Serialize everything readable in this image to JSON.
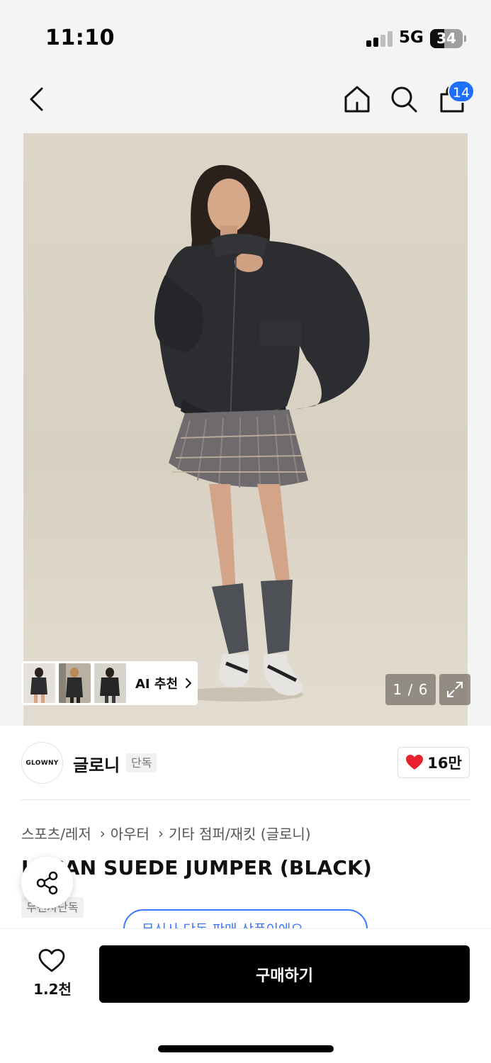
{
  "status_bar": {
    "time": "11:10",
    "network": "5G",
    "battery": "34"
  },
  "nav": {
    "cart_count": "14"
  },
  "gallery": {
    "ai_label": "AI 추천",
    "counter": "1 / 6"
  },
  "brand": {
    "logo_text": "GLOWNY",
    "name": "글로니",
    "tag": "단독",
    "likes": "16만"
  },
  "breadcrumb": [
    "스포츠/레저",
    "아우터",
    "기타 점퍼/재킷 (글로니)"
  ],
  "product": {
    "title": "LUCAN SUEDE JUMPER (BLACK)",
    "exclusive_tag": "무신사단독",
    "info_pill": "무신사 단독 판매 상품이에요"
  },
  "bottom_bar": {
    "wish_count": "1.2천",
    "buy_label": "구매하기"
  },
  "colors": {
    "accent_blue": "#1f6fff",
    "heart_red": "#e8212f",
    "buy_button": "#000000"
  }
}
